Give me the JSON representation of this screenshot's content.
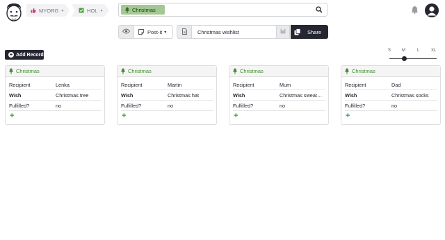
{
  "breadcrumbs": {
    "org": "MYORG",
    "doc": "HOL"
  },
  "search": {
    "tag": "Christmas"
  },
  "toolbar": {
    "view_label": "Post-it",
    "doc_name": "Christmas wishlist",
    "share_label": "Share"
  },
  "add_record_label": "Add Record",
  "size_options": [
    "S",
    "M",
    "L",
    "XL"
  ],
  "size_selected": "M",
  "colors": {
    "dark": "#262633",
    "accent_green": "#3c8f26",
    "pill_green": "#a4c893"
  },
  "cards": [
    {
      "title": "Christmas",
      "fields": [
        {
          "label": "Recipient",
          "value": "Lenka"
        },
        {
          "label": "Wish",
          "value": "Christmas tree"
        },
        {
          "label": "Fulfilled?",
          "value": "no"
        }
      ]
    },
    {
      "title": "Christmas",
      "fields": [
        {
          "label": "Recipient",
          "value": "Martin"
        },
        {
          "label": "Wish",
          "value": "Christmas hat"
        },
        {
          "label": "Fulfilled?",
          "value": "no"
        }
      ]
    },
    {
      "title": "Christmas",
      "fields": [
        {
          "label": "Recipient",
          "value": "Mum"
        },
        {
          "label": "Wish",
          "value": "Christmas sweat…"
        },
        {
          "label": "Fulfilled?",
          "value": "no"
        }
      ]
    },
    {
      "title": "Christmas",
      "fields": [
        {
          "label": "Recipient",
          "value": "Dad"
        },
        {
          "label": "Wish",
          "value": "Christmas socks"
        },
        {
          "label": "Fulfilled?",
          "value": "no"
        }
      ]
    }
  ],
  "icons": {
    "card_header": "tree-icon",
    "card_add": "plus-icon"
  }
}
